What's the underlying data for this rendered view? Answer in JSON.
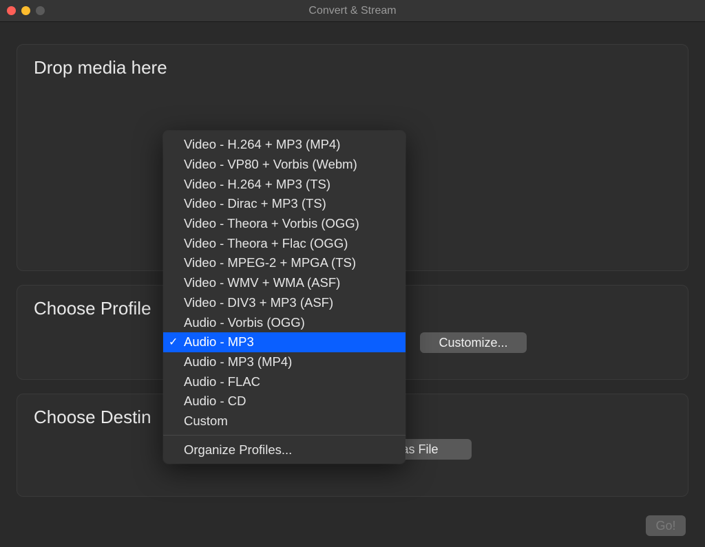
{
  "window": {
    "title": "Convert & Stream"
  },
  "panels": {
    "drop": {
      "title": "Drop media here"
    },
    "profile": {
      "title": "Choose Profile"
    },
    "destination": {
      "title": "Choose Destin"
    }
  },
  "buttons": {
    "customize": "Customize...",
    "as_file": "as File",
    "go": "Go!"
  },
  "dropdown": {
    "items": [
      {
        "label": "Video - H.264 + MP3 (MP4)",
        "selected": false
      },
      {
        "label": "Video - VP80 + Vorbis (Webm)",
        "selected": false
      },
      {
        "label": "Video - H.264 + MP3 (TS)",
        "selected": false
      },
      {
        "label": "Video - Dirac + MP3 (TS)",
        "selected": false
      },
      {
        "label": "Video - Theora + Vorbis (OGG)",
        "selected": false
      },
      {
        "label": "Video - Theora + Flac (OGG)",
        "selected": false
      },
      {
        "label": "Video - MPEG-2 + MPGA (TS)",
        "selected": false
      },
      {
        "label": "Video - WMV + WMA (ASF)",
        "selected": false
      },
      {
        "label": "Video - DIV3 + MP3 (ASF)",
        "selected": false
      },
      {
        "label": "Audio - Vorbis (OGG)",
        "selected": false
      },
      {
        "label": "Audio - MP3",
        "selected": true
      },
      {
        "label": "Audio - MP3 (MP4)",
        "selected": false
      },
      {
        "label": "Audio - FLAC",
        "selected": false
      },
      {
        "label": "Audio - CD",
        "selected": false
      },
      {
        "label": "Custom",
        "selected": false
      }
    ],
    "footer": "Organize Profiles..."
  }
}
